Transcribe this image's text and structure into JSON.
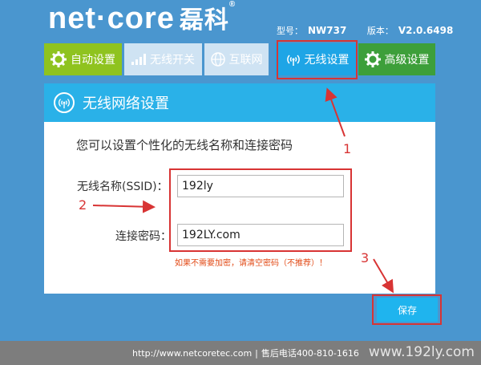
{
  "header": {
    "logo_text": "net·core",
    "logo_cn": "磊科",
    "logo_reg": "®",
    "model_label": "型号：",
    "model_value": "NW737",
    "version_label": "版本：",
    "version_value": "V2.0.6498"
  },
  "nav": {
    "items": [
      {
        "label": "自动设置",
        "icon": "gear-icon"
      },
      {
        "label": "无线开关",
        "icon": "signal-bars-icon"
      },
      {
        "label": "互联网",
        "icon": "globe-icon"
      },
      {
        "label": "无线设置",
        "icon": "wifi-icon"
      },
      {
        "label": "高级设置",
        "icon": "gear-icon"
      }
    ],
    "active": "无线设置"
  },
  "panel": {
    "title": "无线网络设置",
    "intro": "您可以设置个性化的无线名称和连接密码",
    "ssid_label": "无线名称(SSID)：",
    "ssid_value": "192ly",
    "password_label": "连接密码：",
    "password_value": "192LY.com",
    "hint": "如果不需要加密，请清空密码（不推荐）！"
  },
  "actions": {
    "save_label": "保存"
  },
  "annotations": {
    "n1": "1",
    "n2": "2",
    "n3": "3"
  },
  "footer": {
    "url": "http://www.netcoretec.com",
    "separator": "|",
    "phone": "售后电话400-810-1616",
    "watermark": "www.192ly.com"
  },
  "colors": {
    "background": "#4a96cf",
    "accent": "#2ab1e8",
    "nav_auto": "#8fc31f",
    "nav_adv": "#3d9f3a",
    "annotation": "#d83434",
    "hint": "#e24a16"
  }
}
